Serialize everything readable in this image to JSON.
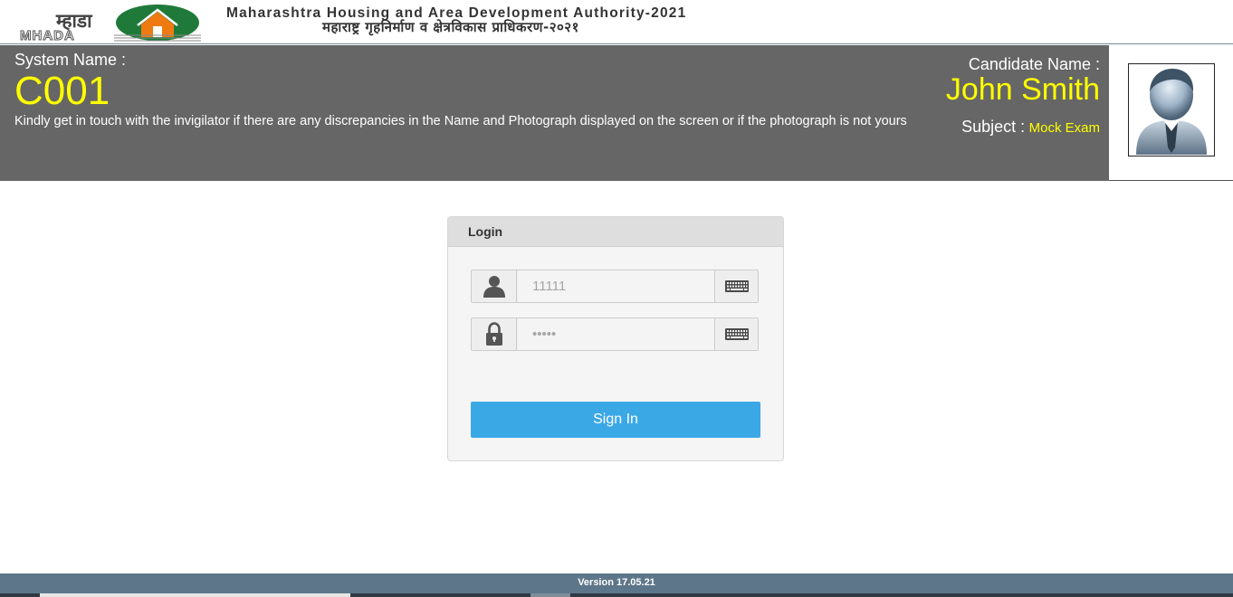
{
  "header": {
    "logo": {
      "text_hi": "म्हाडा",
      "text_en": "MHADA"
    },
    "title_en": "Maharashtra Housing and Area Development Authority-2021",
    "title_hi": "महाराष्ट्र गृहनिर्माण व क्षेत्रविकास प्राधिकरण-२०२१"
  },
  "info": {
    "system_label": "System Name :",
    "system_value": "C001",
    "notice": "Kindly get in touch with the invigilator if there are any discrepancies in the Name and Photograph displayed on the screen or if the photograph is not yours",
    "candidate_label": "Candidate Name :",
    "candidate_value": "John Smith",
    "subject_label": "Subject :",
    "subject_value": "Mock Exam"
  },
  "login": {
    "heading": "Login",
    "username_placeholder": "11111",
    "password_placeholder": "•••••",
    "signin_label": "Sign In"
  },
  "footer": {
    "version": "Version 17.05.21"
  },
  "colors": {
    "accent": "#3ba8e6",
    "highlight": "#ffff00",
    "band": "#666666",
    "footer": "#5d7689"
  },
  "icons": [
    "user-icon",
    "lock-icon",
    "keyboard-icon",
    "avatar-icon",
    "house-emblem-icon"
  ]
}
